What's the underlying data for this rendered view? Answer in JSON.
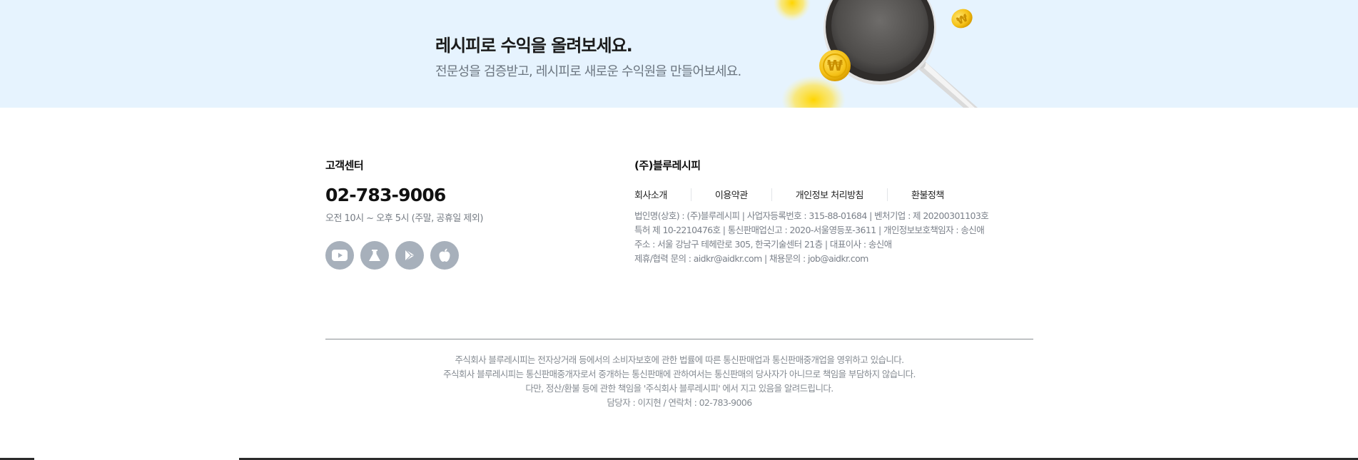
{
  "banner": {
    "title": "레시피로 수익을 올려보세요.",
    "subtitle": "전문성을 검증받고, 레시피로 새로운 수익원을 만들어보세요.",
    "coin_symbol": "₩"
  },
  "customer_center": {
    "title": "고객센터",
    "phone": "02-783-9006",
    "hours": "오전 10시 ~ 오후 5시 (주말, 공휴일 제외)",
    "social": [
      "youtube-icon",
      "flask-icon",
      "google-play-icon",
      "apple-icon"
    ]
  },
  "company": {
    "title": "(주)블루레시피",
    "links": [
      "회사소개",
      "이용약관",
      "개인정보 처리방침",
      "환불정책"
    ],
    "info": [
      "법인명(상호) : (주)블루레시피 | 사업자등록번호 : 315-88-01684 | 벤처기업 : 제 20200301103호",
      "특허 제 10-2210476호 | 통신판매업신고 : 2020-서울영등포-3611 | 개인정보보호책임자 : 송신애",
      "주소 : 서울 강남구 테헤란로 305, 한국기술센터 21층 | 대표이사 : 송신애",
      "제휴/협력 문의 : aidkr@aidkr.com | 채용문의 : job@aidkr.com"
    ]
  },
  "disclaimer": [
    "주식회사 블루레시피는 전자상거래 등에서의 소비자보호에 관한 법률에 따른 통신판매업과 통신판매중개업을 영위하고 있습니다.",
    "주식회사 블루레시피는 통신판매중개자로서 중개하는 통신판매에 관하여서는 통신판매의 당사자가 아니므로 책임을 부담하지 않습니다.",
    "다만, 정산/환불 등에 관한 책임을 '주식회사 블루레시피' 에서 지고 있음을 알려드립니다.",
    "담당자 : 이지현 / 연락처 : 02-783-9006"
  ],
  "colors": {
    "banner_bg": "#e6f3fe",
    "social_bg": "#a7b0bb",
    "coin": "#f7c51e"
  }
}
